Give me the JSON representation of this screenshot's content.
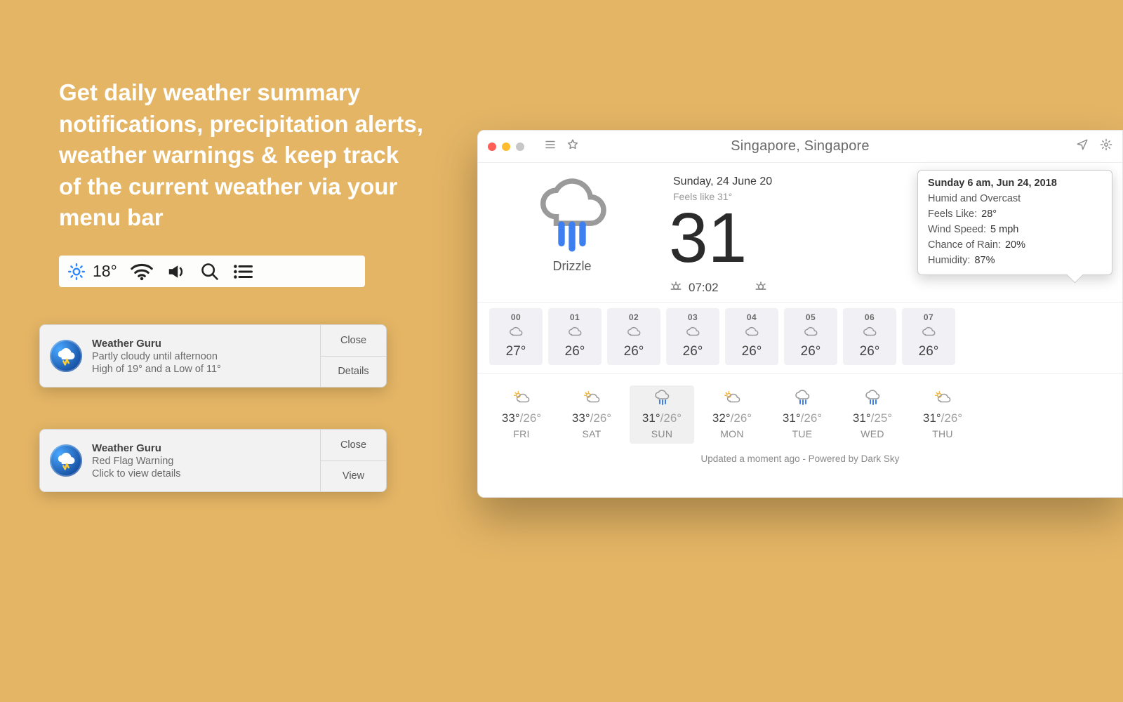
{
  "hero_headline": "Get daily weather summary notifications, precipitation alerts, weather warnings & keep track of the current weather via your menu bar",
  "menubar": {
    "temp": "18°"
  },
  "notifications": [
    {
      "title": "Weather Guru",
      "line1": "Partly cloudy until afternoon",
      "line2": "High of 19° and a Low of 11°",
      "btn1": "Close",
      "btn2": "Details"
    },
    {
      "title": "Weather Guru",
      "line1": "Red Flag Warning",
      "line2": "Click to view details",
      "btn1": "Close",
      "btn2": "View"
    }
  ],
  "app": {
    "location": "Singapore, Singapore",
    "date": "Sunday, 24 June 20",
    "feels": "Feels like 31°",
    "big_temp": "31",
    "condition": "Drizzle",
    "sunrise": "07:02",
    "tooltip": {
      "title": "Sunday 6 am, Jun 24, 2018",
      "summary": "Humid and Overcast",
      "feels_label": "Feels Like:",
      "feels_value": "28°",
      "wind_label": "Wind Speed:",
      "wind_value": "5 mph",
      "rain_label": "Chance of Rain:",
      "rain_value": "20%",
      "humidity_label": "Humidity:",
      "humidity_value": "87%"
    },
    "hourly": [
      {
        "h": "00",
        "t": "27°",
        "icon": "cloud"
      },
      {
        "h": "01",
        "t": "26°",
        "icon": "cloud"
      },
      {
        "h": "02",
        "t": "26°",
        "icon": "cloud"
      },
      {
        "h": "03",
        "t": "26°",
        "icon": "cloud"
      },
      {
        "h": "04",
        "t": "26°",
        "icon": "cloud"
      },
      {
        "h": "05",
        "t": "26°",
        "icon": "cloud"
      },
      {
        "h": "06",
        "t": "26°",
        "icon": "cloud"
      },
      {
        "h": "07",
        "t": "26°",
        "icon": "cloud"
      }
    ],
    "daily": [
      {
        "d": "FRI",
        "t_hi": "33°",
        "t_lo": "/26°",
        "icon": "sun-cloud",
        "selected": false
      },
      {
        "d": "SAT",
        "t_hi": "33°",
        "t_lo": "/26°",
        "icon": "sun-cloud",
        "selected": false
      },
      {
        "d": "SUN",
        "t_hi": "31°",
        "t_lo": "/26°",
        "icon": "rain",
        "selected": true
      },
      {
        "d": "MON",
        "t_hi": "32°",
        "t_lo": "/26°",
        "icon": "sun-cloud",
        "selected": false
      },
      {
        "d": "TUE",
        "t_hi": "31°",
        "t_lo": "/26°",
        "icon": "rain",
        "selected": false
      },
      {
        "d": "WED",
        "t_hi": "31°",
        "t_lo": "/25°",
        "icon": "rain",
        "selected": false
      },
      {
        "d": "THU",
        "t_hi": "31°",
        "t_lo": "/26°",
        "icon": "sun-cloud",
        "selected": false
      }
    ],
    "footer": "Updated a moment ago - Powered by Dark Sky"
  }
}
